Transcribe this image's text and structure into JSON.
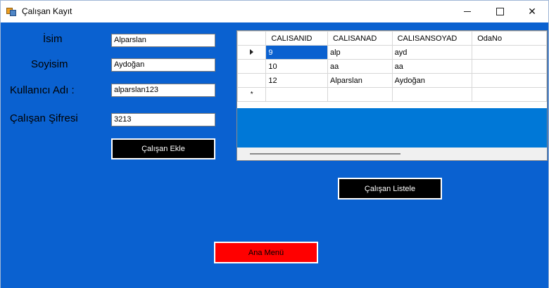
{
  "window": {
    "title": "Çalışan Kayıt"
  },
  "form": {
    "isim_label": "İsim",
    "isim_value": "Alparslan",
    "soyisim_label": "Soyisim",
    "soyisim_value": "Aydoğan",
    "kullanici_label": "Kullanıcı Adı :",
    "kullanici_value": "alparslan123",
    "sifre_label": "Çalışan Şifresi",
    "sifre_value": "3213",
    "ekle_button": "Çalışan Ekle"
  },
  "grid": {
    "columns": [
      "CALISANID",
      "CALISANAD",
      "CALISANSOYAD",
      "OdaNo"
    ],
    "rows": [
      {
        "id": "9",
        "ad": "alp",
        "soyad": "ayd",
        "oda": ""
      },
      {
        "id": "10",
        "ad": "aa",
        "soyad": "aa",
        "oda": ""
      },
      {
        "id": "12",
        "ad": "Alparslan",
        "soyad": "Aydoğan",
        "oda": ""
      }
    ],
    "current_row_marker": "►",
    "new_row_marker": "*"
  },
  "buttons": {
    "listele": "Çalışan Listele",
    "ana_menu": "Ana Menü"
  },
  "colors": {
    "form_background": "#0a61d0",
    "grid_background": "#0078d7",
    "button_dark": "#000000",
    "button_red": "#ff0000"
  }
}
